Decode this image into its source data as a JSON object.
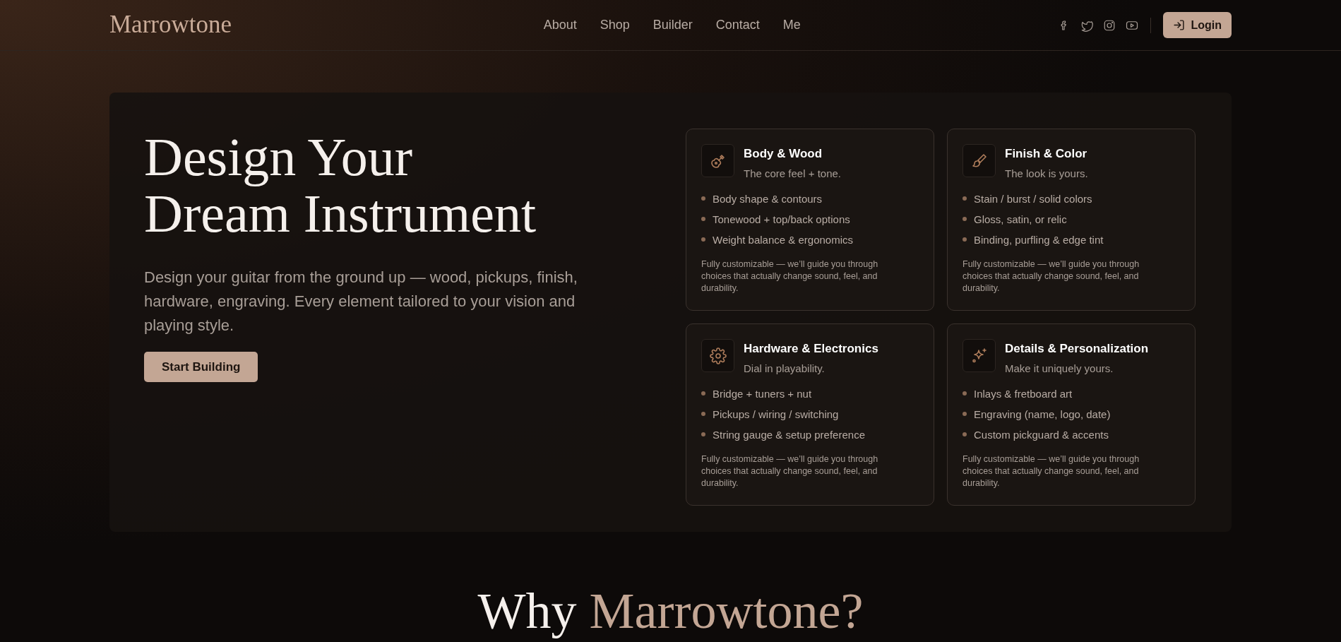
{
  "header": {
    "logo": "Marrowtone",
    "nav": [
      {
        "label": "About"
      },
      {
        "label": "Shop"
      },
      {
        "label": "Builder"
      },
      {
        "label": "Contact"
      },
      {
        "label": "Me"
      }
    ],
    "social": [
      {
        "kind": "facebook"
      },
      {
        "kind": "twitter"
      },
      {
        "kind": "instagram"
      },
      {
        "kind": "youtube"
      }
    ],
    "login": "Login"
  },
  "hero": {
    "title_lines": [
      "Design Your",
      "Dream Instrument"
    ],
    "description": "Design your guitar from the ground up — wood, pickups, finish, hardware, engraving. Every element tailored to your vision and playing style.",
    "button": "Start Building"
  },
  "cards": [
    {
      "kind": "guitar",
      "title": "Body & Wood",
      "subtitle": "The core feel + tone.",
      "items": [
        "Body shape & contours",
        "Tonewood + top/back options",
        "Weight balance & ergonomics"
      ],
      "note": "Fully customizable — we’ll guide you through choices that actually change sound, feel, and durability."
    },
    {
      "kind": "brush",
      "title": "Finish & Color",
      "subtitle": "The look is yours.",
      "items": [
        "Stain / burst / solid colors",
        "Gloss, satin, or relic",
        "Binding, purfling & edge tint"
      ],
      "note": "Fully customizable — we’ll guide you through choices that actually change sound, feel, and durability."
    },
    {
      "kind": "gear",
      "title": "Hardware & Electronics",
      "subtitle": "Dial in playability.",
      "items": [
        "Bridge + tuners + nut",
        "Pickups / wiring / switching",
        "String gauge & setup preference"
      ],
      "note": "Fully customizable — we’ll guide you through choices that actually change sound, feel, and durability."
    },
    {
      "kind": "sparkle",
      "title": "Details & Personalization",
      "subtitle": "Make it uniquely yours.",
      "items": [
        "Inlays & fretboard art",
        "Engraving (name, logo, date)",
        "Custom pickguard & accents"
      ],
      "note": "Fully customizable — we’ll guide you through choices that actually change sound, feel, and durability."
    }
  ],
  "why": {
    "lead": "Why",
    "accent": "Marrowtone?"
  }
}
